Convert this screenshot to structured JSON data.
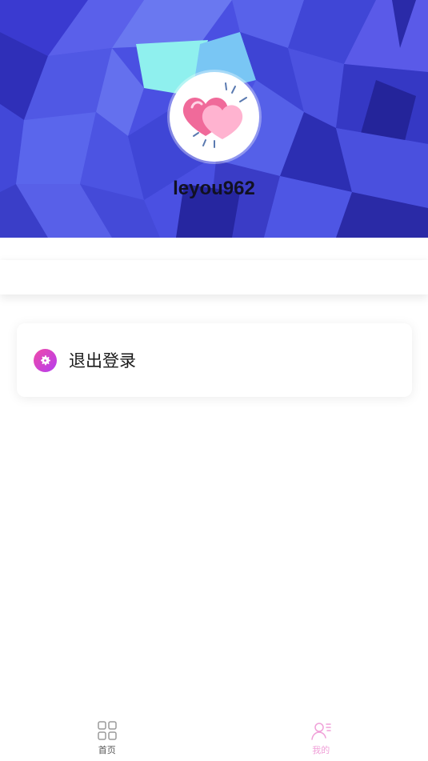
{
  "profile": {
    "username": "leyou962"
  },
  "menu": {
    "logout_label": "退出登录"
  },
  "tabbar": {
    "home_label": "首页",
    "mine_label": "我的",
    "active_tab": "mine"
  },
  "colors": {
    "banner_base": "#4a4fe0",
    "accent_pink": "#f04aa8",
    "accent_purple": "#b43df0",
    "active_tab": "#f0a0d8"
  },
  "icons": {
    "avatar": "double-heart-icon",
    "logout": "gear-icon",
    "home": "grid-icon",
    "mine": "user-icon"
  }
}
